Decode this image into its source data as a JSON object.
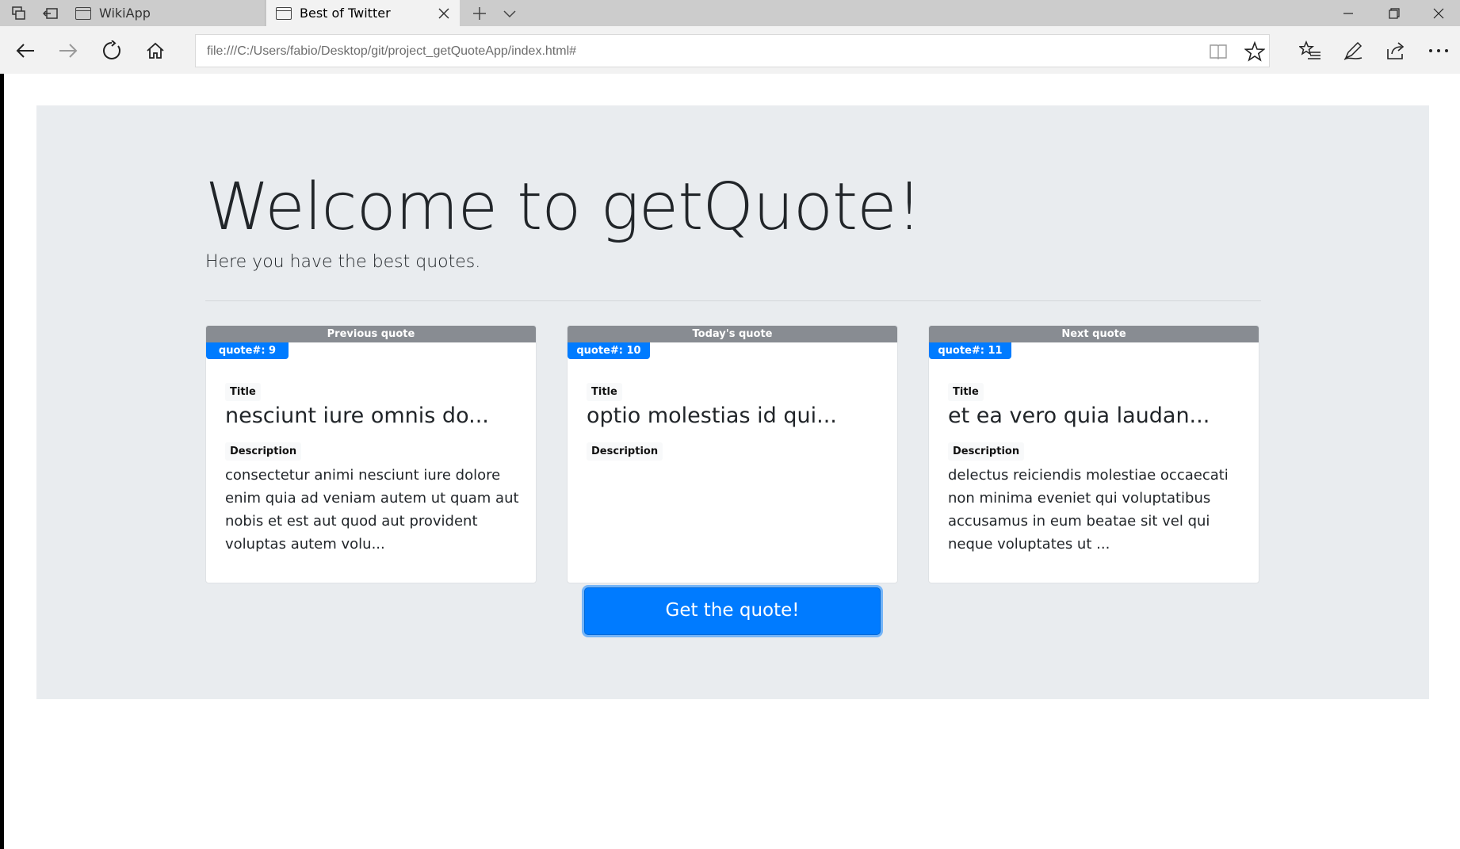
{
  "browser": {
    "tabs": [
      {
        "label": "WikiApp",
        "active": false
      },
      {
        "label": "Best of Twitter",
        "active": true
      }
    ],
    "address": "file:///C:/Users/fabio/Desktop/git/project_getQuoteApp/index.html#",
    "icons": {
      "tab_manager": "tabs-icon",
      "set_aside": "set-aside-tabs-icon",
      "new_tab": "plus-icon",
      "tab_preview": "chevron-down-icon",
      "back": "arrow-left-icon",
      "forward": "arrow-right-icon",
      "refresh": "refresh-icon",
      "home": "home-icon",
      "reading_view": "book-icon",
      "favorite": "star-icon",
      "favorites_hub": "hub-icon",
      "notes": "pen-icon",
      "share": "share-icon",
      "more": "more-icon"
    }
  },
  "page": {
    "title": "Welcome to getQuote!",
    "lead": "Here you have the best quotes.",
    "cards": [
      {
        "header": "Previous quote",
        "badge": "quote#: 9",
        "title_label": "Title",
        "title": "nesciunt iure omnis do...",
        "description_label": "Description",
        "description": "consectetur animi nesciunt iure dolore enim quia ad veniam autem ut quam aut nobis et est aut quod aut provident voluptas autem volu..."
      },
      {
        "header": "Today's quote",
        "badge": "quote#: 10",
        "title_label": "Title",
        "title": "optio molestias id qui...",
        "description_label": "Description",
        "description": ""
      },
      {
        "header": "Next quote",
        "badge": "quote#: 11",
        "title_label": "Title",
        "title": "et ea vero quia laudan...",
        "description_label": "Description",
        "description": "delectus reiciendis molestiae occaecati non minima eveniet qui voluptatibus accusamus in eum beatae sit vel qui neque voluptates ut ..."
      }
    ],
    "button_label": "Get the quote!"
  },
  "colors": {
    "primary": "#007bff",
    "jumbotron": "#e9ecef",
    "card_header": "#888c92"
  }
}
